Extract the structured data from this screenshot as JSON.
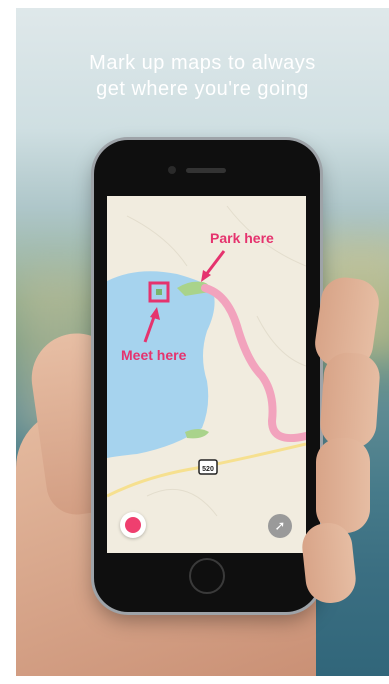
{
  "headline": {
    "line1": "Mark up maps to always",
    "line2": "get where you're going"
  },
  "annotations": {
    "park_label": "Park here",
    "meet_label": "Meet here"
  },
  "map": {
    "highway_shield": "520"
  },
  "controls": {
    "record_icon": "record-icon",
    "compass_icon": "compass-icon"
  },
  "colors": {
    "annotation": "#e5336e",
    "water": "#a6d3ee",
    "route": "#f2a3bd",
    "park": "#a9d38b",
    "road": "#f6e08f",
    "land": "#f1ecdf"
  }
}
